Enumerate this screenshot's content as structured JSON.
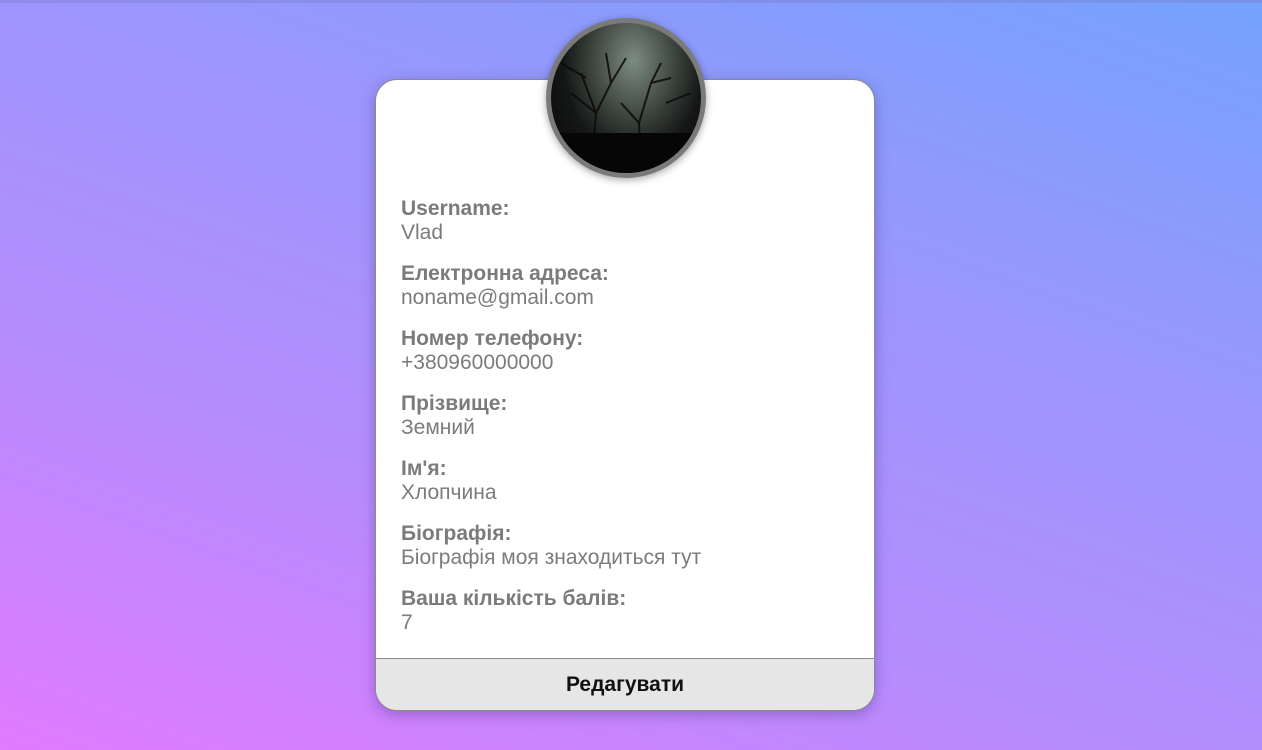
{
  "profile": {
    "avatar_icon": "user-avatar-photo",
    "fields": [
      {
        "label": "Username:",
        "value": "Vlad"
      },
      {
        "label": "Електронна адреса:",
        "value": "noname@gmail.com"
      },
      {
        "label": "Номер телефону:",
        "value": "+380960000000"
      },
      {
        "label": "Прізвище:",
        "value": "Земний"
      },
      {
        "label": "Ім'я:",
        "value": "Хлопчина"
      },
      {
        "label": "Біографія:",
        "value": "Біографія моя знаходиться тут"
      },
      {
        "label": "Ваша кількість балів:",
        "value": "7"
      }
    ],
    "edit_label": "Редагувати"
  },
  "colors": {
    "background_start": "#e07aff",
    "background_end": "#74a2fc",
    "card": "#ffffff",
    "text": "#7b7b7b",
    "button": "#e6e6e6"
  }
}
